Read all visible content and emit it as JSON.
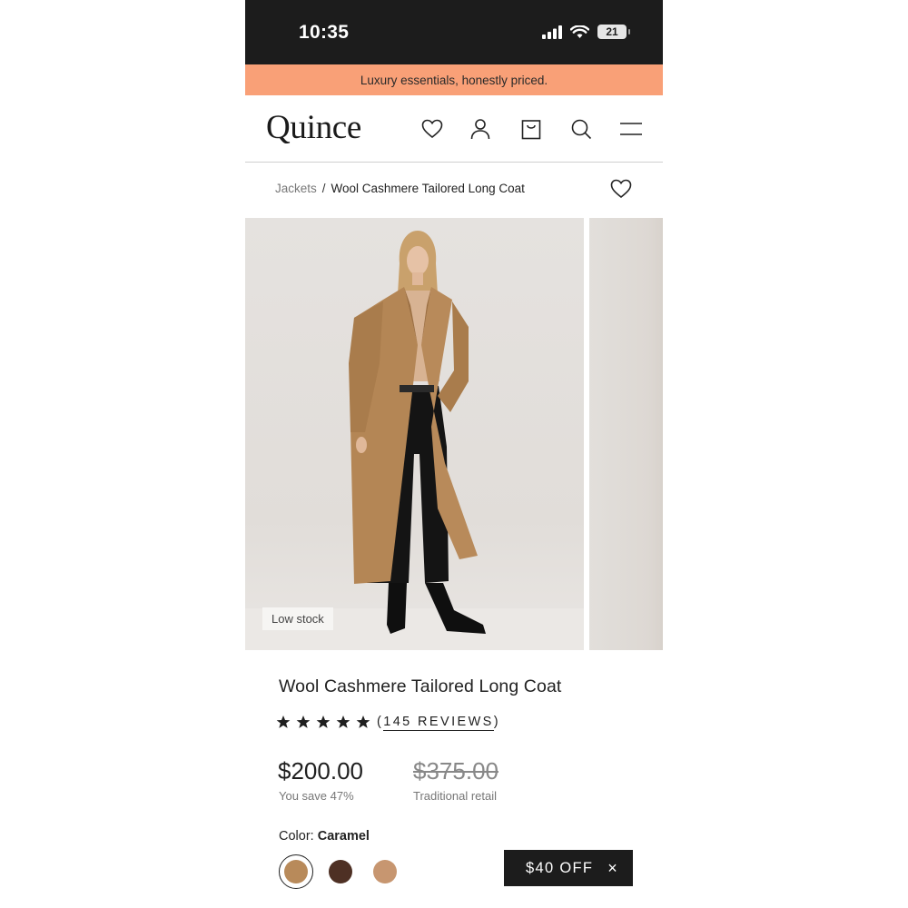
{
  "status_bar": {
    "time": "10:35",
    "battery": "21"
  },
  "promo": {
    "text": "Luxury essentials, honestly priced."
  },
  "header": {
    "logo": "Quince",
    "icons": [
      "heart-icon",
      "user-icon",
      "bag-icon",
      "search-icon",
      "menu-icon"
    ]
  },
  "breadcrumb": {
    "parent": "Jackets",
    "separator": "/",
    "current": "Wool Cashmere Tailored Long Coat"
  },
  "gallery": {
    "badge": "Low stock"
  },
  "product": {
    "title": "Wool Cashmere Tailored Long Coat",
    "rating": 5,
    "reviews_open": "(",
    "reviews_label": "145 REVIEWS",
    "reviews_close": ")",
    "price": "$200.00",
    "savings": "You save 47%",
    "retail_price": "$375.00",
    "retail_label": "Traditional retail",
    "color_label": "Color: ",
    "color_name": "Caramel",
    "swatches": [
      {
        "name": "Caramel",
        "hex": "#b88a5a",
        "selected": true
      },
      {
        "name": "Brown",
        "hex": "#4e3024",
        "selected": false
      },
      {
        "name": "Camel",
        "hex": "#c79670",
        "selected": false
      }
    ]
  },
  "offer": {
    "label": "$40 OFF",
    "close": "×"
  },
  "colors": {
    "promo_bg": "#f9a077",
    "status_bg": "#1c1c1c",
    "coat": "#b88a5a"
  }
}
